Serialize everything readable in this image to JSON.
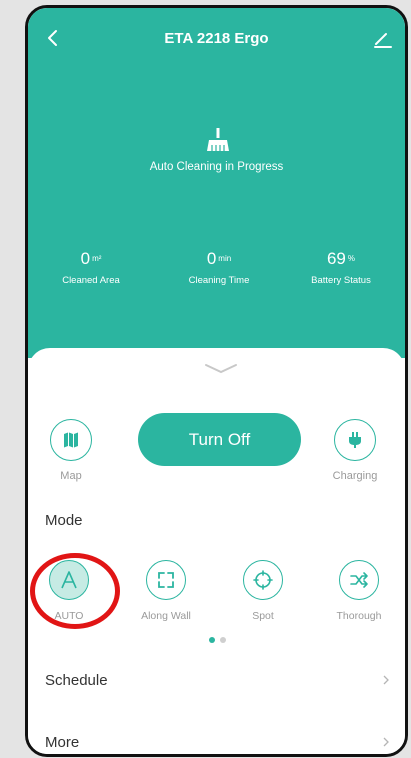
{
  "header": {
    "title": "ETA 2218 Ergo"
  },
  "status": {
    "text": "Auto Cleaning in Progress"
  },
  "stats": [
    {
      "value": "0",
      "unit": "m²",
      "label": "Cleaned Area"
    },
    {
      "value": "0",
      "unit": "min",
      "label": "Cleaning Time"
    },
    {
      "value": "69",
      "unit": "%",
      "label": "Battery Status"
    }
  ],
  "controls": {
    "map_label": "Map",
    "turn_off_label": "Turn Off",
    "charging_label": "Charging"
  },
  "mode": {
    "title": "Mode",
    "items": [
      {
        "label": "AUTO",
        "icon": "auto-a-icon",
        "selected": true
      },
      {
        "label": "Along Wall",
        "icon": "along-wall-icon",
        "selected": false
      },
      {
        "label": "Spot",
        "icon": "spot-icon",
        "selected": false
      },
      {
        "label": "Thorough",
        "icon": "shuffle-icon",
        "selected": false
      }
    ],
    "pager": {
      "pages": 2,
      "current": 1
    }
  },
  "menu": {
    "schedule_label": "Schedule",
    "more_label": "More"
  },
  "colors": {
    "accent": "#2bb5a0",
    "highlight": "#e11515"
  }
}
